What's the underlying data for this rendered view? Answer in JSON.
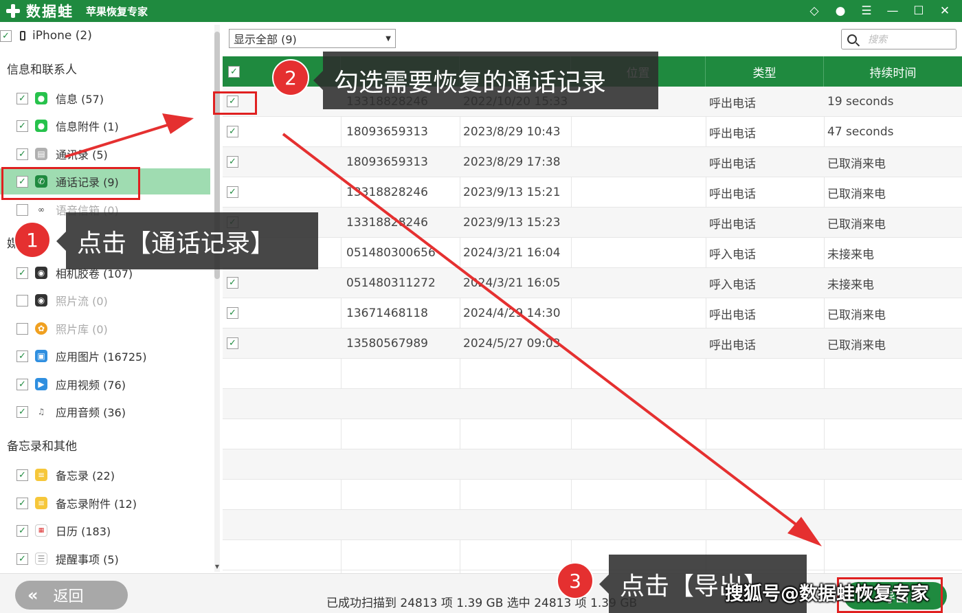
{
  "titlebar": {
    "brand": "数据蛙",
    "subtitle": "苹果恢复专家"
  },
  "sidebar": {
    "device_label": "iPhone (2)",
    "sections": [
      {
        "title": "信息和联系人",
        "items": [
          {
            "label": "信息 (57)",
            "icon": "message-icon",
            "checked": true
          },
          {
            "label": "信息附件 (1)",
            "icon": "attachment-icon",
            "checked": true
          },
          {
            "label": "通讯录 (5)",
            "icon": "contacts-icon",
            "checked": true
          },
          {
            "label": "通话记录 (9)",
            "icon": "phone-icon",
            "checked": true,
            "selected": true
          },
          {
            "label": "语音信箱 (0)",
            "icon": "voicemail-icon",
            "checked": false
          }
        ]
      },
      {
        "title": "媒",
        "items": [
          {
            "label": "相机胶卷 (107)",
            "icon": "camera-icon",
            "checked": true
          },
          {
            "label": "照片流 (0)",
            "icon": "camera-icon",
            "checked": false
          },
          {
            "label": "照片库 (0)",
            "icon": "photos-icon",
            "checked": false
          },
          {
            "label": "应用图片 (16725)",
            "icon": "image-icon",
            "checked": true
          },
          {
            "label": "应用视频 (76)",
            "icon": "video-icon",
            "checked": true
          },
          {
            "label": "应用音频 (36)",
            "icon": "music-icon",
            "checked": true
          }
        ]
      },
      {
        "title": "备忘录和其他",
        "items": [
          {
            "label": "备忘录 (22)",
            "icon": "notes-icon",
            "checked": true
          },
          {
            "label": "备忘录附件 (12)",
            "icon": "notes-icon",
            "checked": true
          },
          {
            "label": "日历 (183)",
            "icon": "calendar-icon",
            "checked": true
          },
          {
            "label": "提醒事项 (5)",
            "icon": "reminder-icon",
            "checked": true
          }
        ]
      }
    ]
  },
  "toolbar": {
    "filter_value": "显示全部 (9)",
    "search_placeholder": "搜索"
  },
  "table": {
    "columns": [
      "",
      "",
      "",
      "位置",
      "类型",
      "持续时间"
    ],
    "rows": [
      {
        "number": "13318828246",
        "time": "2022/10/20 15:33",
        "type": "呼出电话",
        "duration": "19 seconds"
      },
      {
        "number": "18093659313",
        "time": "2023/8/29 10:43",
        "type": "呼出电话",
        "duration": "47 seconds"
      },
      {
        "number": "18093659313",
        "time": "2023/8/29 17:38",
        "type": "呼出电话",
        "duration": "已取消来电"
      },
      {
        "number": "13318828246",
        "time": "2023/9/13 15:21",
        "type": "呼出电话",
        "duration": "已取消来电"
      },
      {
        "number": "13318828246",
        "time": "2023/9/13 15:23",
        "type": "呼出电话",
        "duration": "已取消来电"
      },
      {
        "number": "051480300656",
        "time": "2024/3/21 16:04",
        "type": "呼入电话",
        "duration": "未接来电"
      },
      {
        "number": "051480311272",
        "time": "2024/3/21 16:05",
        "type": "呼入电话",
        "duration": "未接来电"
      },
      {
        "number": "13671468118",
        "time": "2024/4/29 14:30",
        "type": "呼出电话",
        "duration": "已取消来电"
      },
      {
        "number": "13580567989",
        "time": "2024/5/27 09:03",
        "type": "呼出电话",
        "duration": "已取消来电"
      }
    ]
  },
  "bottom": {
    "back_label": "返回",
    "status": "已成功扫描到 24813 项 1.39 GB  选中 24813 项 1.39 GB",
    "export_label": "导出"
  },
  "annotations": {
    "step1_number": "1",
    "step1_text": "点击【通话记录】",
    "step2_number": "2",
    "step2_text": "勾选需要恢复的通话记录",
    "step3_number": "3",
    "step3_text": "点击【导出】",
    "watermark": "搜狐号@数据蛙恢复专家"
  },
  "colors": {
    "brand_green": "#1f8a3f",
    "selected_row": "#9fdcb1",
    "annotation_red": "#e02020"
  }
}
